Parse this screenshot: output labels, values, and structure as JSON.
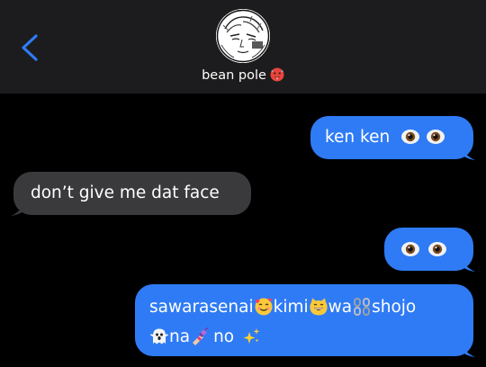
{
  "header": {
    "back_icon": "chevron-left-icon",
    "contact_name": "bean pole",
    "contact_emoji": "hot-face-emoji",
    "accent_color": "#2f7bf5"
  },
  "messages": [
    {
      "direction": "outgoing",
      "text": "ken ken",
      "trailing_emojis": [
        "eyes-emoji",
        "eyes-emoji"
      ]
    },
    {
      "direction": "incoming",
      "text": "don’t give me dat face"
    },
    {
      "direction": "outgoing",
      "text": "",
      "trailing_emojis": [
        "eyes-emoji",
        "eyes-emoji"
      ]
    },
    {
      "direction": "outgoing",
      "segments": [
        {
          "text": "sawarasenai"
        },
        {
          "emoji": "smiling-face-with-hearts-emoji"
        },
        {
          "text": "kimi"
        },
        {
          "emoji": "grinning-cat-emoji"
        },
        {
          "text": "wa"
        },
        {
          "emoji": "chains-emoji"
        },
        {
          "text": "shojo"
        },
        {
          "emoji": "ghost-emoji"
        },
        {
          "text": "na"
        },
        {
          "emoji": "nail-polish-emoji"
        },
        {
          "text": "no"
        },
        {
          "emoji": "sparkles-emoji"
        }
      ]
    }
  ],
  "colors": {
    "background": "#000000",
    "header_background": "#1c1c1e",
    "outgoing_bubble": "#2f7bf5",
    "incoming_bubble": "#3a3a3c",
    "text": "#ffffff"
  }
}
